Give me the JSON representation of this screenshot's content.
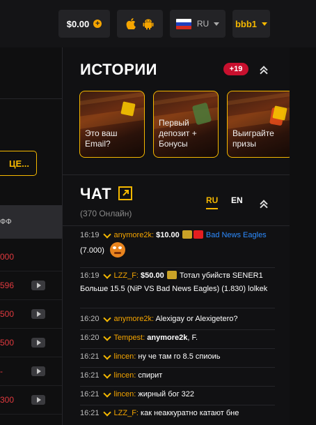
{
  "topbar": {
    "balance": "$0.00",
    "balance_plus_icon": "plus-circle-icon",
    "app_icons": [
      "apple-icon",
      "android-icon"
    ],
    "language": "RU",
    "username": "bbb1",
    "colors": {
      "accent": "#f5b800",
      "badge": "#c8102e",
      "link": "#2d8cff",
      "danger": "#e0393e"
    }
  },
  "left": {
    "cta_label": "ЦЕ...",
    "table_header": "ФФ",
    "rows": [
      {
        "value": "000",
        "video": false
      },
      {
        "value": "596",
        "video": true
      },
      {
        "value": "500",
        "video": true
      },
      {
        "value": "500",
        "video": true
      },
      {
        "value": "-",
        "video": true
      },
      {
        "value": "300",
        "video": true
      }
    ]
  },
  "stories": {
    "title": "ИСТОРИИ",
    "badge": "+19",
    "items": [
      {
        "label": "Это ваш Email?"
      },
      {
        "label": "Первый депозит + Бонусы"
      },
      {
        "label": "Выиграйте призы"
      }
    ]
  },
  "chat": {
    "title": "ЧАТ",
    "online": "(370 Онлайн)",
    "tabs": {
      "ru": "RU",
      "en": "EN"
    },
    "messages": [
      {
        "time": "16:19",
        "nick": "anymore2k:",
        "amount": "$10.00",
        "team": "Bad News Eagles",
        "odds": "(7.000)"
      },
      {
        "time": "16:19",
        "nick": "LZZ_F:",
        "amount": "$50.00",
        "text": "Тотал убийств SENER1 Больше 15.5 (NiP VS Bad News Eagles) (1.830) lolkek"
      },
      {
        "time": "16:20",
        "nick": "anymore2k:",
        "text": "Alexigay or Alexigetero?"
      },
      {
        "time": "16:20",
        "nick": "Tempest:",
        "mention": "anymore2k",
        "text": ", F."
      },
      {
        "time": "16:21",
        "nick": "lincen:",
        "text": "ну че там го 8.5 спиоиь"
      },
      {
        "time": "16:21",
        "nick": "lincen:",
        "text": "спирит"
      },
      {
        "time": "16:21",
        "nick": "lincen:",
        "text": "жирный бог 322"
      },
      {
        "time": "16:21",
        "nick": "LZZ_F:",
        "text": "как неаккуратно катают бне"
      }
    ]
  }
}
